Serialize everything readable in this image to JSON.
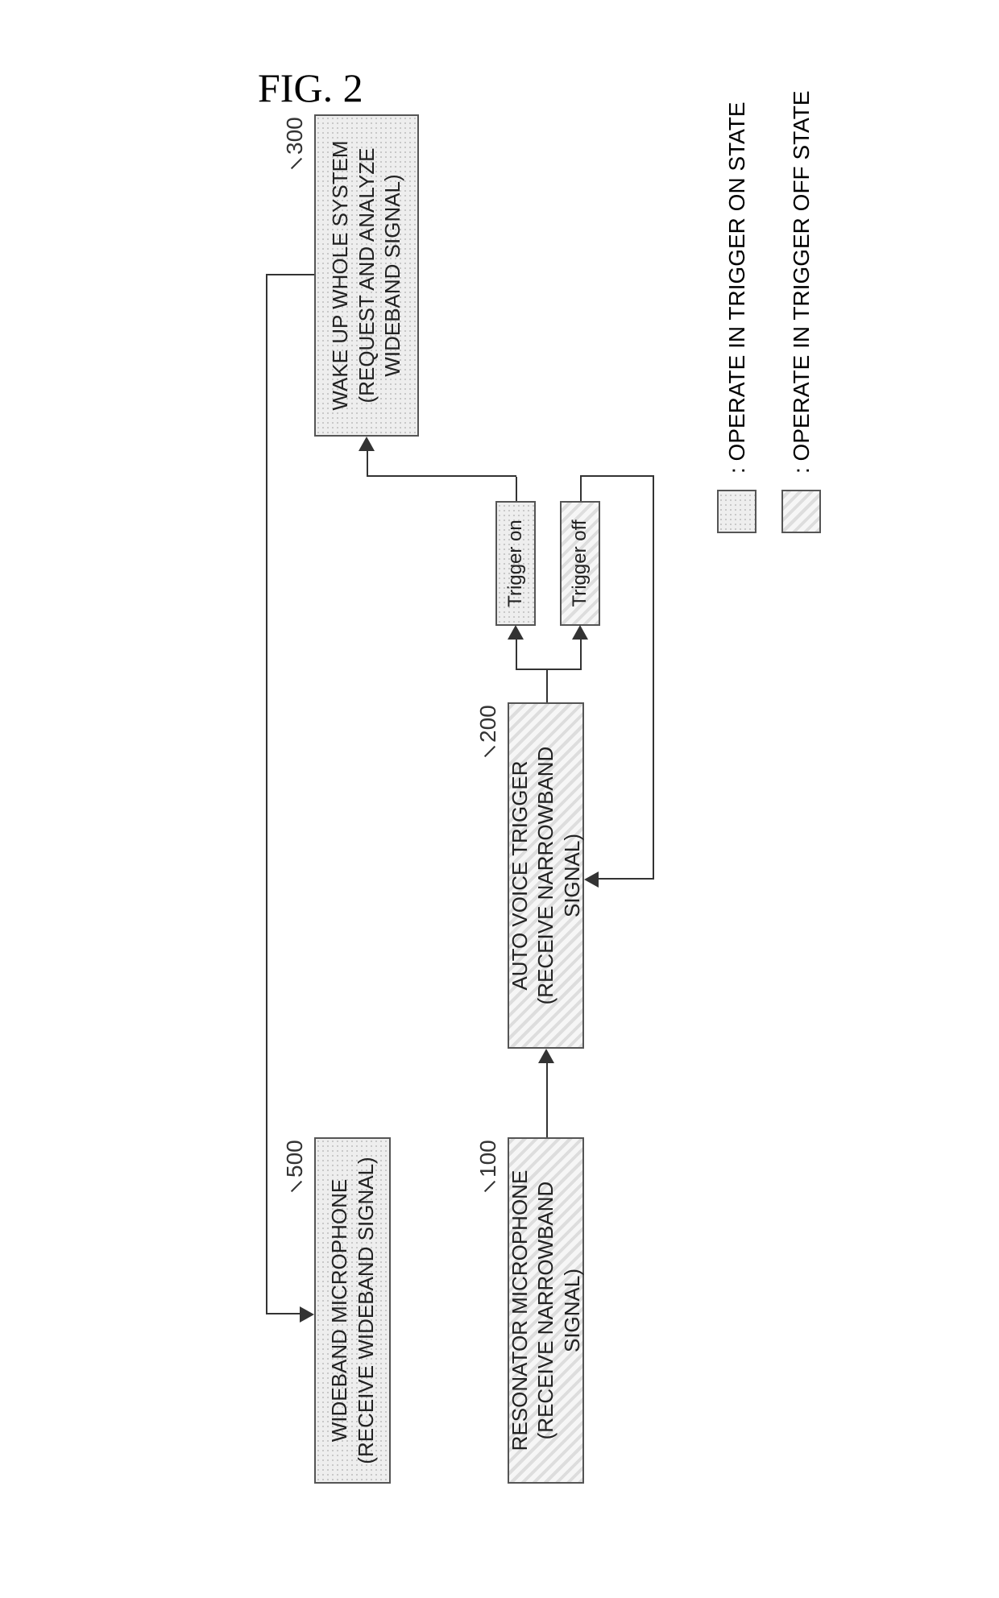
{
  "figure_title": "FIG. 2",
  "blocks": {
    "wideband_mic": {
      "ref": "500",
      "title": "WIDEBAND MICROPHONE",
      "subtitle": "(RECEIVE WIDEBAND SIGNAL)"
    },
    "resonator_mic": {
      "ref": "100",
      "title": "RESONATOR MICROPHONE",
      "subtitle": "(RECEIVE NARROWBAND SIGNAL)"
    },
    "auto_voice_trigger": {
      "ref": "200",
      "title": "AUTO VOICE TRIGGER",
      "subtitle": "(RECEIVE NARROWBAND SIGNAL)"
    },
    "trigger_on": {
      "label": "Trigger on"
    },
    "trigger_off": {
      "label": "Trigger off"
    },
    "wake_up": {
      "ref": "300",
      "title": "WAKE UP WHOLE SYSTEM",
      "subtitle": "(REQUEST AND ANALYZE\nWIDEBAND SIGNAL)"
    }
  },
  "legend": {
    "on": ": OPERATE IN TRIGGER ON STATE",
    "off": ": OPERATE IN TRIGGER OFF STATE"
  },
  "chart_data": {
    "type": "flow-diagram",
    "nodes": [
      {
        "id": "resonator_mic",
        "label": "RESONATOR MICROPHONE (RECEIVE NARROWBAND SIGNAL)",
        "ref": "100",
        "state": "trigger_off"
      },
      {
        "id": "auto_voice_trigger",
        "label": "AUTO VOICE TRIGGER (RECEIVE NARROWBAND SIGNAL)",
        "ref": "200",
        "state": "trigger_off"
      },
      {
        "id": "trigger_on",
        "label": "Trigger on",
        "state": "trigger_on"
      },
      {
        "id": "trigger_off",
        "label": "Trigger off",
        "state": "trigger_off"
      },
      {
        "id": "wake_up",
        "label": "WAKE UP WHOLE SYSTEM (REQUEST AND ANALYZE WIDEBAND SIGNAL)",
        "ref": "300",
        "state": "trigger_on"
      },
      {
        "id": "wideband_mic",
        "label": "WIDEBAND MICROPHONE (RECEIVE WIDEBAND SIGNAL)",
        "ref": "500",
        "state": "trigger_on"
      }
    ],
    "edges": [
      {
        "from": "resonator_mic",
        "to": "auto_voice_trigger"
      },
      {
        "from": "auto_voice_trigger",
        "to": "trigger_on"
      },
      {
        "from": "auto_voice_trigger",
        "to": "trigger_off"
      },
      {
        "from": "trigger_on",
        "to": "wake_up"
      },
      {
        "from": "trigger_off",
        "to": "auto_voice_trigger"
      },
      {
        "from": "wake_up",
        "to": "wideband_mic"
      }
    ],
    "legend": {
      "trigger_on": "OPERATE IN TRIGGER ON STATE",
      "trigger_off": "OPERATE IN TRIGGER OFF STATE"
    }
  }
}
